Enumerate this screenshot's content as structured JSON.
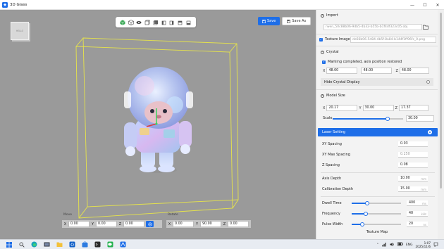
{
  "window": {
    "title": "3D Glass",
    "controls": [
      "—",
      "☐",
      "✕"
    ]
  },
  "viewport": {
    "background": "#9a9a9a",
    "cube_label": "HELLO",
    "toolbar_icons": [
      "cube-solid-icon",
      "cube-wire-icon",
      "eye-icon",
      "view-front-icon",
      "view-back-icon",
      "view-left-icon",
      "view-right-icon",
      "view-top-icon",
      "view-bottom-icon"
    ],
    "save_label": "Save",
    "save_as_label": "Save As",
    "move": {
      "label": "Move",
      "x": "0.00",
      "y": "0.00",
      "z": "0.00"
    },
    "rotate": {
      "label": "Rotate",
      "x": "0.00",
      "y": "90.00",
      "z": "0.00"
    }
  },
  "panel": {
    "import": {
      "title": "Import",
      "file": "rwen_50c88b06-9db5-4b32-b55b-b1f4df323c05.obj"
    },
    "texture": {
      "checked": true,
      "label": "Texture Image",
      "file": "de66b06-5d84-4b5f-8a84-b144f1ff96fc_0.png"
    },
    "crystal": {
      "title": "Crystal",
      "status": "Marking completed, axis position restored",
      "x": "48.00",
      "y": "48.00",
      "z": "48.00",
      "hide_label": "Hide Crystal Display"
    },
    "model_size": {
      "title": "Model Size",
      "x": "20.17",
      "y": "30.00",
      "z": "17.37",
      "scale_label": "Scale",
      "scale_value": "30.00",
      "scale_fraction": 0.78
    },
    "laser": {
      "title": "Laser Setting",
      "xy_spacing_label": "XY Spacing",
      "xy_spacing": "0.03",
      "xy_max_spacing_label": "XY Max Spacing",
      "xy_max_spacing": "0.250",
      "z_spacing_label": "Z Spacing",
      "z_spacing": "0.08",
      "axis_depth_label": "Axis Depth",
      "axis_depth": "10.00",
      "axis_depth_unit": "mm",
      "calib_label": "Calibration Depth",
      "calib": "15.00",
      "calib_unit": "mm",
      "dwell_label": "Dwell Time",
      "dwell": "400",
      "dwell_fraction": 0.32,
      "dwell_unit": "ms",
      "freq_label": "Frequency",
      "freq": "40",
      "freq_fraction": 0.28,
      "freq_unit": "kHz",
      "pulse_label": "Pulse Width",
      "pulse": "20",
      "pulse_fraction": 0.22,
      "pulse_unit": "ns",
      "texture_map_label": "Texture Map"
    }
  },
  "taskbar": {
    "lang": "ENG",
    "time": "1:07",
    "date": "2025/11/6"
  },
  "colors": {
    "accent": "#1e6ee8",
    "box_wire": "#e7e44a",
    "axis_green": "#3cd35e",
    "axis_red": "#e03838"
  }
}
